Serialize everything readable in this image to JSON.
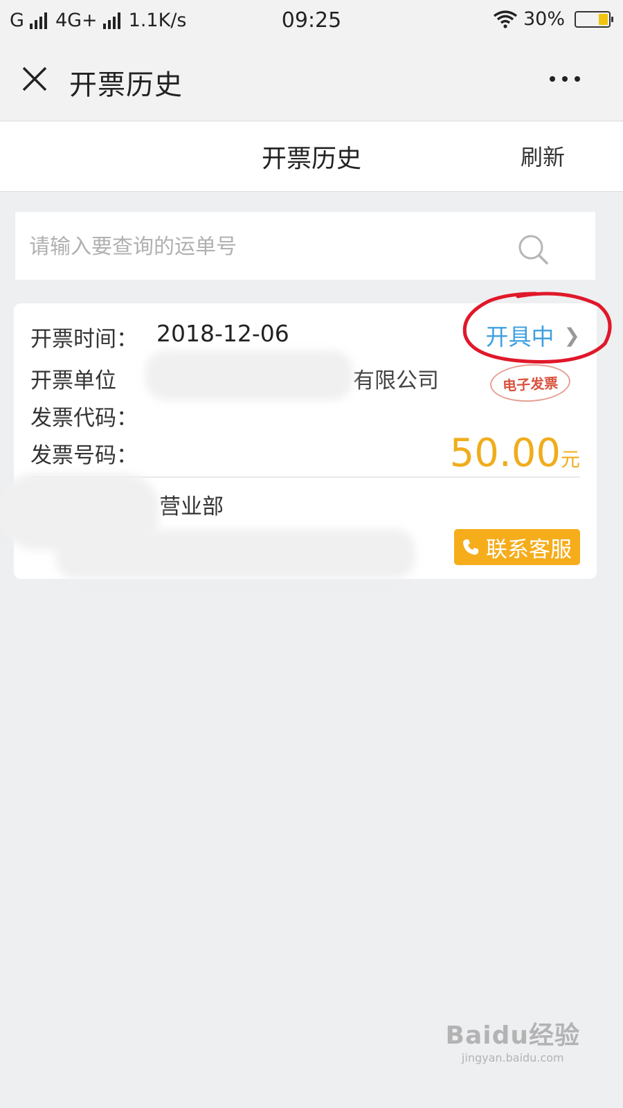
{
  "status_bar": {
    "carrier": "G",
    "network": "4G+",
    "speed": "1.1K/s",
    "time": "09:25",
    "battery": "30%",
    "battery_level": 0.3
  },
  "app_header": {
    "title": "开票历史",
    "close_icon": "close-icon",
    "more_icon": "more-icon"
  },
  "page_bar": {
    "title": "开票历史",
    "refresh_label": "刷新"
  },
  "search": {
    "placeholder": "请输入要查询的运单号",
    "icon": "search-icon"
  },
  "invoice": {
    "time_label": "开票时间：",
    "date": "2018-12-06",
    "status": "开具中",
    "unit_label": "开票单位",
    "unit_value_visible": "有限公司",
    "code_label": "发票代码：",
    "number_label": "发票号码：",
    "amount": "50.00",
    "currency": "元",
    "stamp": "电子发票",
    "dept_visible": "营业部",
    "contact_label": "联系客服"
  },
  "watermark": {
    "main": "Baidu经验",
    "sub": "jingyan.baidu.com"
  },
  "colors": {
    "status_blue": "#3ea0e0",
    "amount_orange": "#f0ad1b",
    "contact_button": "#f5ad1b",
    "annotation_red": "#e0182a"
  }
}
